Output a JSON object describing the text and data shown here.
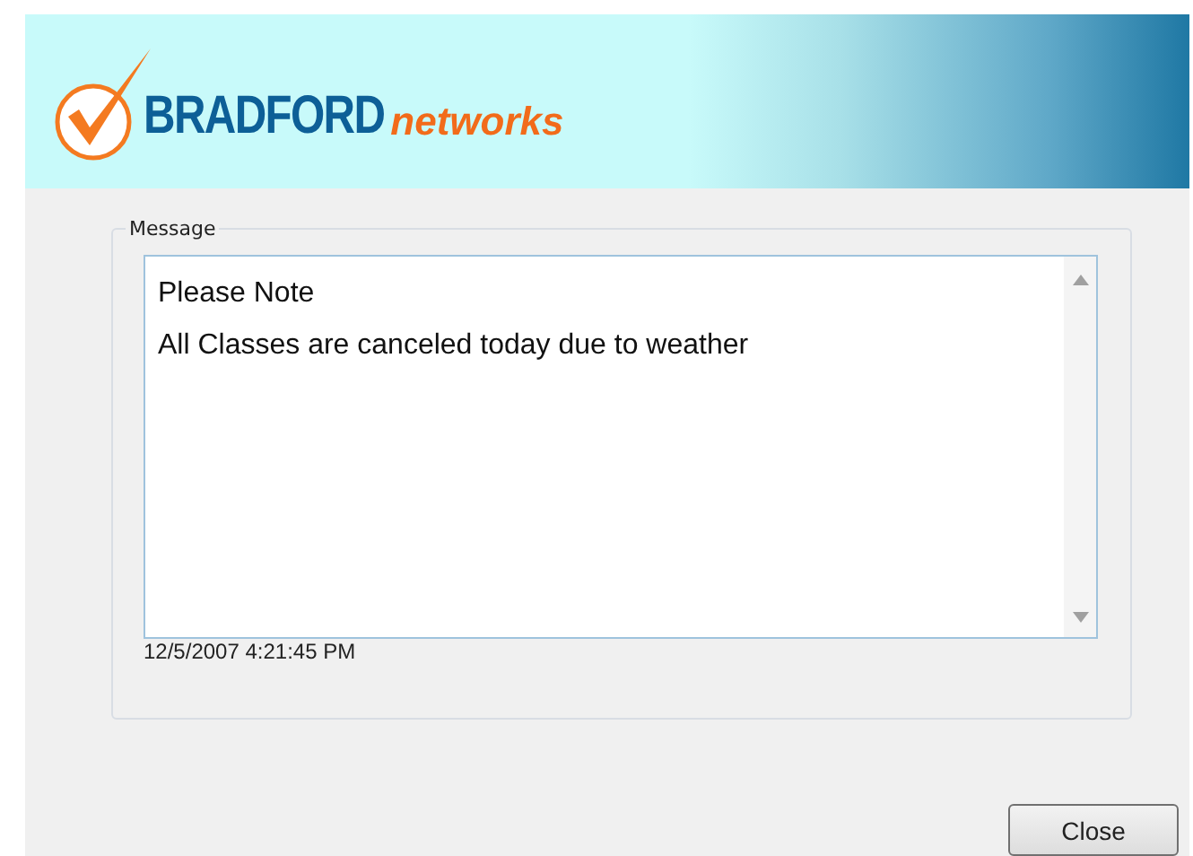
{
  "logo": {
    "brand": "BRADFORD",
    "suffix": "networks"
  },
  "message": {
    "label": "Message",
    "lines": [
      "Please Note",
      "All Classes are canceled today due to weather"
    ],
    "timestamp": "12/5/2007 4:21:45 PM"
  },
  "buttons": [
    {
      "label": "Close"
    }
  ]
}
